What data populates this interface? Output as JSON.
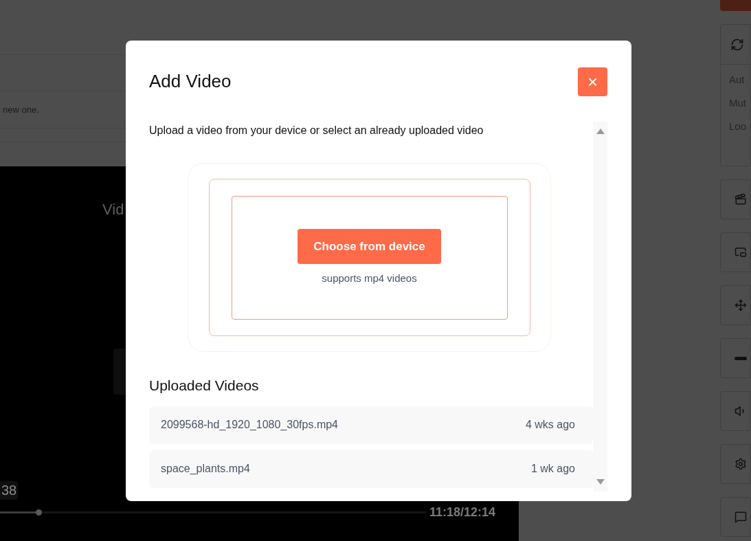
{
  "background": {
    "notice": "new one.",
    "player": {
      "title": "Vid",
      "time_badge": "38",
      "progress": {
        "level": 0.09
      },
      "time": "11:18/12:14"
    },
    "settings_card": {
      "options": [
        "Aut",
        "Mut",
        "Loo"
      ]
    }
  },
  "dialog": {
    "title": "Add Video",
    "close": "×",
    "description": "Upload a video from your device or select an already uploaded video",
    "upload": {
      "button": "Choose from device",
      "hint": "supports mp4 videos"
    },
    "uploaded_title": "Uploaded Videos",
    "videos": [
      {
        "name": "2099568-hd_1920_1080_30fps.mp4",
        "age": "4 wks ago"
      },
      {
        "name": "space_plants.mp4",
        "age": "1 wk ago"
      }
    ]
  }
}
